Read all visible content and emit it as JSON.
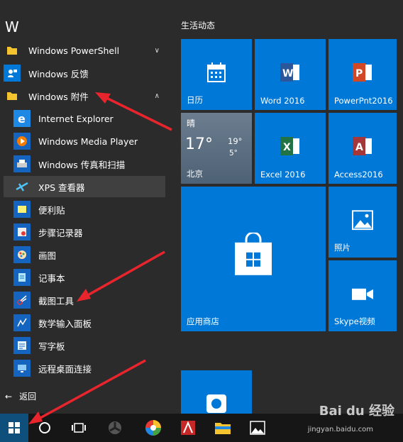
{
  "app_list": {
    "letter": "W",
    "items": [
      {
        "label": "Windows PowerShell",
        "icon": "folder-icon"
      },
      {
        "label": "Windows 反馈",
        "icon": "feedback-icon"
      },
      {
        "label": "Windows 附件",
        "icon": "folder-icon"
      },
      {
        "label": "Internet Explorer",
        "icon": "internet-explorer-icon"
      },
      {
        "label": "Windows Media Player",
        "icon": "media-player-icon"
      },
      {
        "label": "Windows 传真和扫描",
        "icon": "fax-scan-icon"
      },
      {
        "label": "XPS 查看器",
        "icon": "xps-viewer-icon"
      },
      {
        "label": "便利贴",
        "icon": "sticky-notes-icon"
      },
      {
        "label": "步骤记录器",
        "icon": "steps-recorder-icon"
      },
      {
        "label": "画图",
        "icon": "paint-icon"
      },
      {
        "label": "记事本",
        "icon": "notepad-icon"
      },
      {
        "label": "截图工具",
        "icon": "snipping-tool-icon"
      },
      {
        "label": "数学输入面板",
        "icon": "math-input-icon"
      },
      {
        "label": "写字板",
        "icon": "wordpad-icon"
      },
      {
        "label": "远程桌面连接",
        "icon": "remote-desktop-icon"
      }
    ],
    "back_label": "返回"
  },
  "tiles": {
    "header": "生活动态",
    "calendar": "日历",
    "word": "Word 2016",
    "powerpoint": "PowerPnt2016",
    "weather": {
      "condition": "晴",
      "temp": "17°",
      "high": "19°",
      "low": "5°",
      "city": "北京"
    },
    "excel": "Excel 2016",
    "access": "Access2016",
    "store": "应用商店",
    "photos": "照片",
    "skype": "Skype视频"
  },
  "watermark": {
    "brand": "Bai du 经验",
    "url": "jingyan.baidu.com"
  },
  "colors": {
    "tile": "#0078d7",
    "background": "#2b2b2b",
    "taskbar": "#161616",
    "arrow": "#e8242d",
    "selected_row": "#404040"
  }
}
